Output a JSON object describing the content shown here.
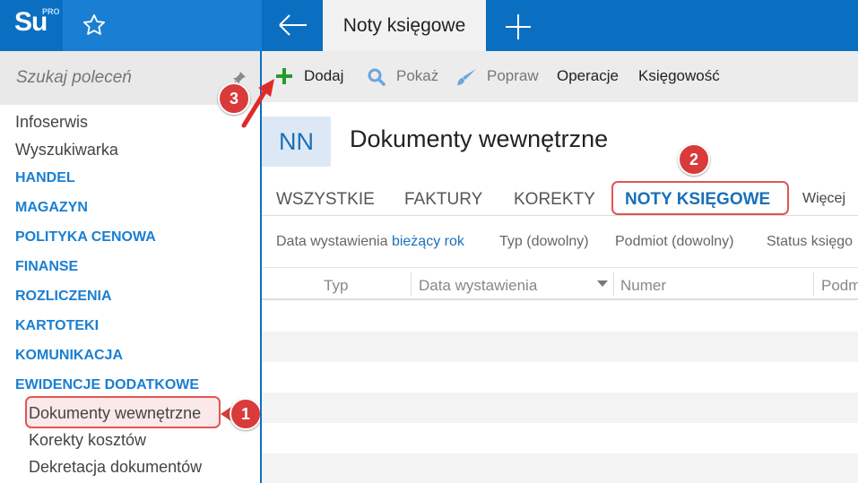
{
  "app": {
    "logo": "Su",
    "logo_superscript": "PRO",
    "active_tab": "Noty księgowe"
  },
  "sidebar": {
    "search_placeholder": "Szukaj poleceń",
    "items": [
      {
        "label": "Infoserwis",
        "type": "item"
      },
      {
        "label": "Wyszukiwarka",
        "type": "item"
      },
      {
        "label": "HANDEL",
        "type": "section"
      },
      {
        "label": "MAGAZYN",
        "type": "section"
      },
      {
        "label": "POLITYKA CENOWA",
        "type": "section"
      },
      {
        "label": "FINANSE",
        "type": "section"
      },
      {
        "label": "ROZLICZENIA",
        "type": "section"
      },
      {
        "label": "KARTOTEKI",
        "type": "section"
      },
      {
        "label": "KOMUNIKACJA",
        "type": "section"
      },
      {
        "label": "EWIDENCJE DODATKOWE",
        "type": "section"
      }
    ],
    "sub_items": [
      {
        "label": "Dokumenty wewnętrzne",
        "selected": true
      },
      {
        "label": "Korekty kosztów"
      },
      {
        "label": "Dekretacja dokumentów"
      }
    ]
  },
  "toolbar": {
    "add_label": "Dodaj",
    "show_label": "Pokaż",
    "edit_label": "Popraw",
    "operations_label": "Operacje",
    "accounting_label": "Księgowość"
  },
  "header": {
    "abbr": "NN",
    "title": "Dokumenty wewnętrzne"
  },
  "tabs": {
    "all": "WSZYSTKIE",
    "invoices": "FAKTURY",
    "corrections": "KOREKTY",
    "selected": "NOTY KSIĘGOWE",
    "more": "Więcej"
  },
  "filters": {
    "date_label": "Data wystawienia",
    "date_value": "bieżący rok",
    "type": "Typ (dowolny)",
    "subject": "Podmiot (dowolny)",
    "status": "Status księgo"
  },
  "grid": {
    "columns": [
      "Typ",
      "Data wystawienia",
      "Numer",
      "Podm"
    ]
  },
  "annotations": {
    "badge_1": "1",
    "badge_2": "2",
    "badge_3": "3"
  },
  "colors": {
    "brand_blue": "#0b6fc1",
    "accent_blue": "#1a7fd2",
    "link_blue": "#1a6fb8",
    "annotation_red": "#d93a3a",
    "add_green": "#2a9a2a"
  },
  "icons": {
    "star": "star-icon",
    "back": "arrow-left-icon",
    "new_tab": "plus-icon",
    "pin": "pin-icon",
    "add": "plus-icon",
    "search": "magnifier-icon",
    "edit": "brush-icon",
    "sort": "chevron-down-icon"
  }
}
